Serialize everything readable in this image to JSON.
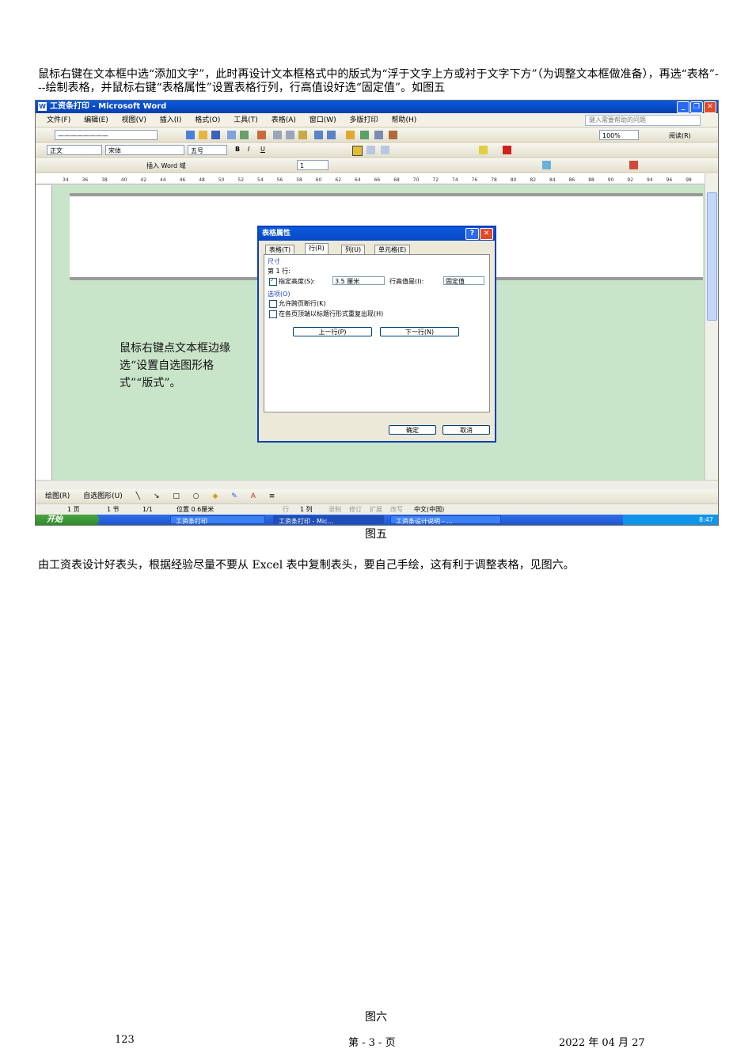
{
  "text": {
    "paragraph1": "鼠标右键在文本框中选“添加文字”，此时再设计文本框格式中的版式为“浮于文字上方或衬于文字下方”（为调整文本框做准备），再选“表格”---绘制表格，并鼠标右键“表格属性”设置表格行列，行高值设好选“固定值”。如图五",
    "figure5_caption": "图五",
    "paragraph2": "由工资表设计好表头，根据经验尽量不要从 Excel 表中复制表头，要自己手绘，这有利于调整表格，见图六。",
    "figure6_caption": "图六"
  },
  "footer": {
    "left": "123",
    "center": "第 - 3 - 页",
    "right": "2022 年 04 月 27"
  },
  "screenshot": {
    "window_title": "工资条打印 - Microsoft Word",
    "menus": [
      "文件(F)",
      "编辑(E)",
      "视图(V)",
      "插入(I)",
      "格式(O)",
      "工具(T)",
      "表格(A)",
      "窗口(W)",
      "多版打印",
      "帮助(H)"
    ],
    "help_placeholder": "键入需要帮助的问题",
    "style_combo": "正文",
    "font_combo": "宋体",
    "size_combo": "五号",
    "zoom_combo": "100%",
    "read_button": "阅读(R)",
    "insert_word_field": "插入 Word 域",
    "page_nav_value": "1",
    "ruler_ticks": [
      "34",
      "36",
      "38",
      "40",
      "42",
      "44",
      "46",
      "48",
      "50",
      "52",
      "54",
      "56",
      "58",
      "60",
      "62",
      "64",
      "66",
      "68",
      "70",
      "72",
      "74",
      "76",
      "78",
      "80",
      "82",
      "84",
      "86",
      "88",
      "90",
      "92",
      "94",
      "96",
      "98"
    ],
    "note": "鼠标右键点文本框边缘选“设置自选图形格式”“版式”。",
    "drawing_toolbar": {
      "draw_menu": "绘图(R)",
      "autoshapes": "自选图形(U)"
    },
    "status": {
      "page": "1 页",
      "section": "1 节",
      "pages": "1/1",
      "position": "位置 0.6厘米",
      "line": "行",
      "column": "1 列",
      "rec": "录制",
      "trk": "修订",
      "ext": "扩展",
      "ovr": "改写",
      "lang": "中文(中国)"
    },
    "taskbar": {
      "start": "开始",
      "tasks": [
        "工资条打印",
        "工资条打印 - Mic...",
        "工资条设计说明 - ..."
      ],
      "clock": "8:47"
    },
    "dialog": {
      "title": "表格属性",
      "tabs": [
        "表格(T)",
        "行(R)",
        "列(U)",
        "单元格(E)"
      ],
      "selected_tab": "行(R)",
      "size_group": "尺寸",
      "row_label": "第 1 行:",
      "specify_height_label": "指定高度(S):",
      "height_value": "3.5 厘米",
      "row_height_is_label": "行高值是(I):",
      "row_height_is_value": "固定值",
      "options_group": "选项(O)",
      "option1": "允许跨页断行(K)",
      "option2": "在各页顶端以标题行形式重复出现(H)",
      "prev_row": "上一行(P)",
      "next_row": "下一行(N)",
      "ok": "确定",
      "cancel": "取消"
    }
  }
}
